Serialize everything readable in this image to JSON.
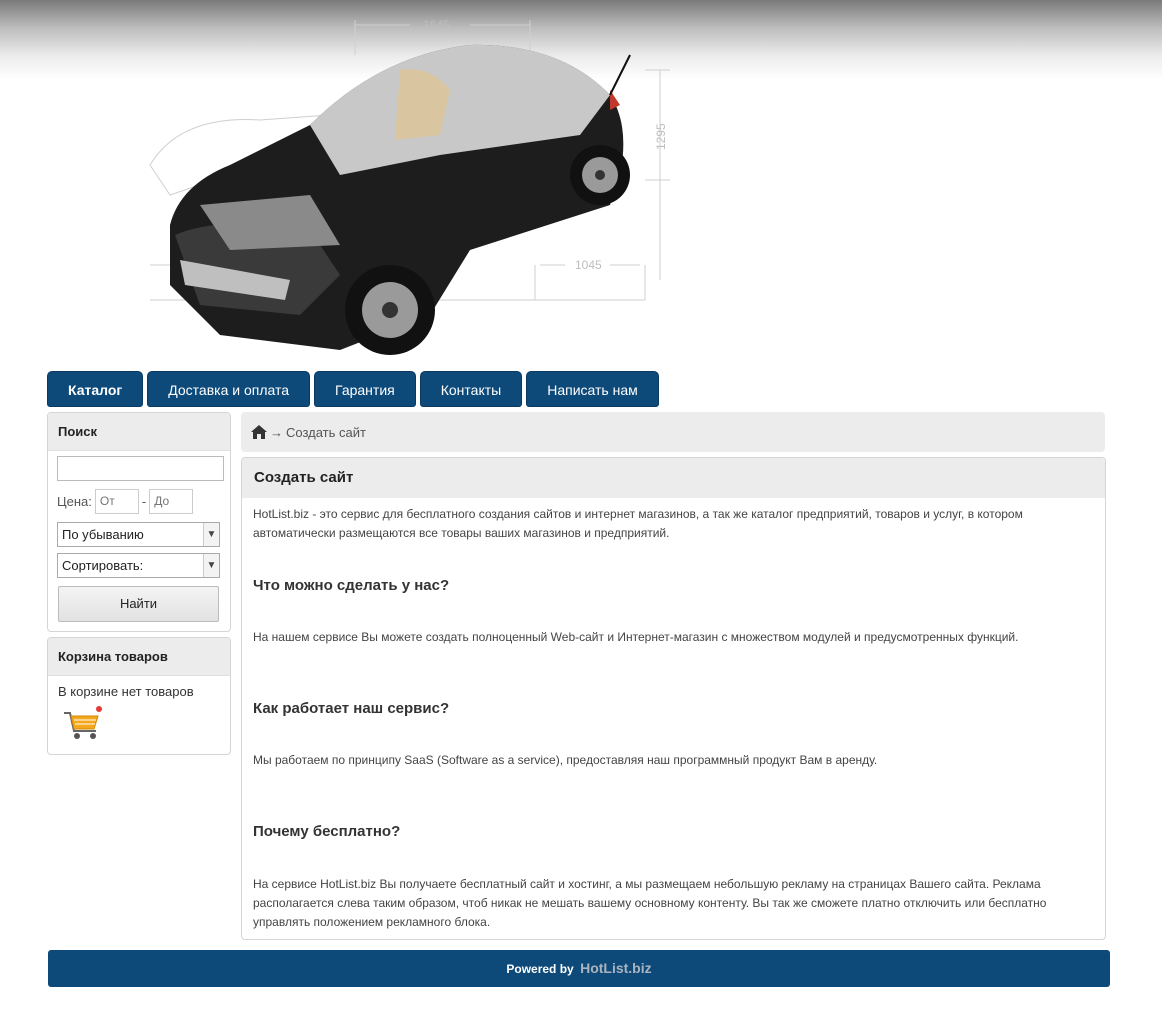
{
  "header": {
    "dimension_top": "1645",
    "dimension_side": "1295",
    "dimension_bottom": "1045"
  },
  "nav": {
    "items": [
      {
        "label": "Каталог"
      },
      {
        "label": "Доставка и оплата"
      },
      {
        "label": "Гарантия"
      },
      {
        "label": "Контакты"
      },
      {
        "label": "Написать нам"
      }
    ]
  },
  "search": {
    "title": "Поиск",
    "query_value": "",
    "price_label": "Цена:",
    "price_from_placeholder": "От",
    "price_separator": "-",
    "price_to_placeholder": "До",
    "order_select": "По убыванию",
    "sort_select": "Сортировать:",
    "submit_label": "Найти"
  },
  "cart": {
    "title": "Корзина товаров",
    "empty_text": "В корзине нет товаров"
  },
  "breadcrumb": {
    "arrow": "→",
    "current": "Создать сайт"
  },
  "content": {
    "title": "Создать сайт",
    "intro": "HotList.biz - это сервис для бесплатного создания сайтов и интернет магазинов, а так же каталог предприятий, товаров и услуг, в котором автоматически размещаются все товары ваших магазинов и предприятий.",
    "sections": [
      {
        "heading": "Что можно сделать у нас?",
        "text": "На нашем сервисе Вы можете создать полноценный Web-сайт и Интернет-магазин с множеством модулей и предусмотренных функций."
      },
      {
        "heading": "Как работает наш сервис?",
        "text": "Мы работаем по принципу SaaS (Software as a service), предоставляя наш программный продукт Вам в аренду."
      },
      {
        "heading": "Почему бесплатно?",
        "text": "На сервисе HotList.biz Вы получаете бесплатный сайт и хостинг, а мы размещаем небольшую рекламу на страницах Вашего сайта. Реклама располагается слева таким образом, чтоб никак не мешать вашему основному контенту. Вы так же сможете платно отключить или бесплатно управлять положением рекламного блока."
      }
    ]
  },
  "footer": {
    "powered_by": "Powered by",
    "brand": "HotList.biz"
  },
  "colors": {
    "nav_bg": "#0d4a7a",
    "panel_header": "#ececec"
  }
}
